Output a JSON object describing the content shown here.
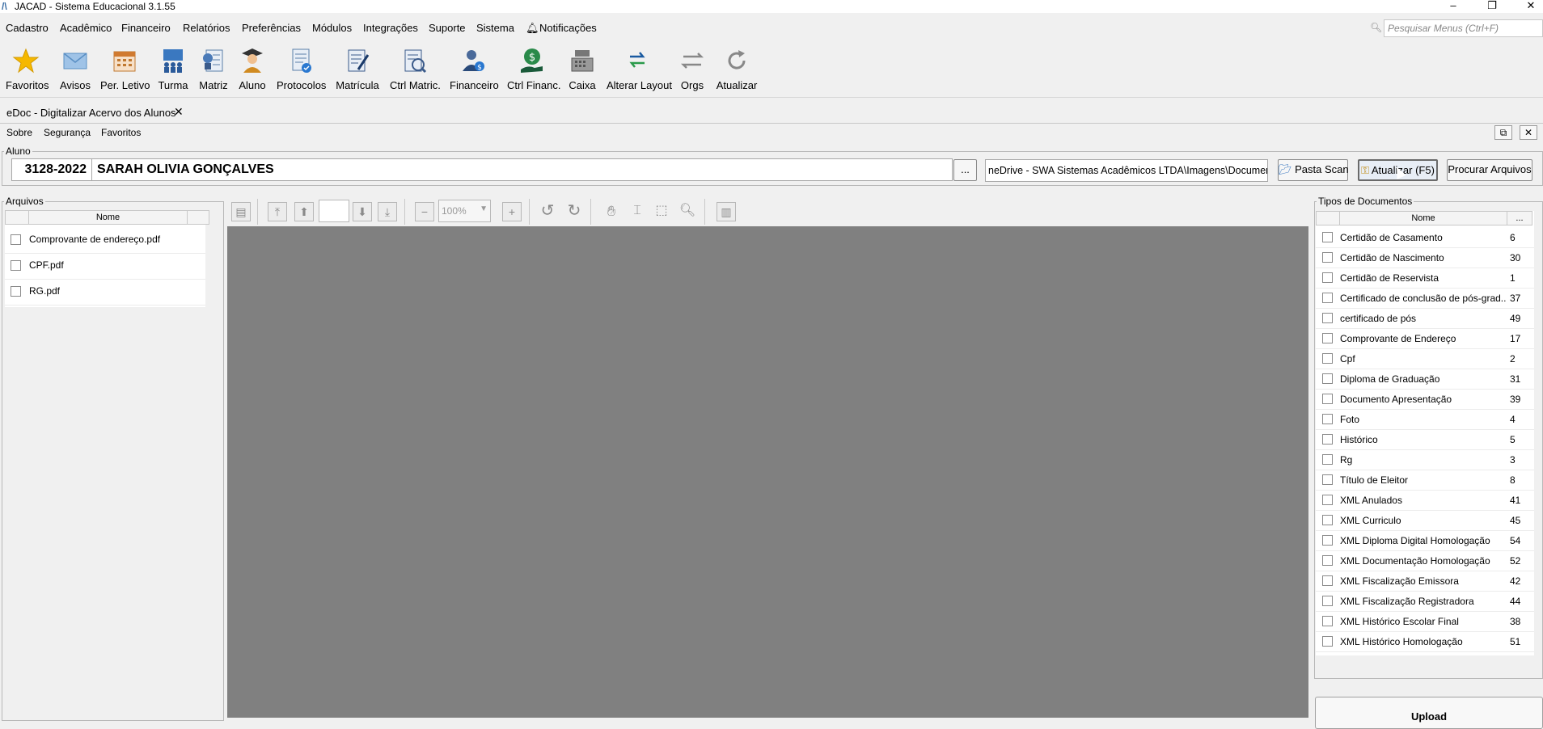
{
  "window": {
    "title": "JACAD - Sistema Educacional 3.1.55",
    "controls": [
      "minimize",
      "restore",
      "close"
    ]
  },
  "menubar": {
    "items": [
      {
        "label": "Cadastro"
      },
      {
        "label": "Acadêmico"
      },
      {
        "label": "Financeiro"
      },
      {
        "label": "Relatórios"
      },
      {
        "label": "Preferências"
      },
      {
        "label": "Módulos"
      },
      {
        "label": "Integrações"
      },
      {
        "label": "Suporte"
      },
      {
        "label": "Sistema"
      },
      {
        "label": "Notificações"
      }
    ],
    "search_placeholder": "Pesquisar Menus (Ctrl+F)"
  },
  "toolbar": {
    "items": [
      {
        "label": "Favoritos",
        "icon": "star-icon"
      },
      {
        "label": "Avisos",
        "icon": "envelope-icon"
      },
      {
        "label": "Per. Letivo",
        "icon": "calendar-icon"
      },
      {
        "label": "Turma",
        "icon": "class-group-icon"
      },
      {
        "label": "Matriz",
        "icon": "matrix-icon"
      },
      {
        "label": "Aluno",
        "icon": "student-icon"
      },
      {
        "label": "Protocolos",
        "icon": "protocol-icon"
      },
      {
        "label": "Matrícula",
        "icon": "enrollment-icon"
      },
      {
        "label": "Ctrl Matric.",
        "icon": "enrollment-control-icon"
      },
      {
        "label": "Financeiro",
        "icon": "finance-person-icon"
      },
      {
        "label": "Ctrl Financ.",
        "icon": "finance-control-icon"
      },
      {
        "label": "Caixa",
        "icon": "cash-register-icon"
      },
      {
        "label": "Alterar Layout",
        "icon": "layout-swap-icon"
      },
      {
        "label": "Orgs",
        "icon": "orgs-arrows-icon"
      },
      {
        "label": "Atualizar",
        "icon": "refresh-icon"
      }
    ]
  },
  "tab": {
    "title": "eDoc - Digitalizar Acervo dos Alunos",
    "close": "✕"
  },
  "submenu": {
    "items": [
      "Sobre",
      "Segurança",
      "Favoritos"
    ]
  },
  "aluno": {
    "legend": "Aluno",
    "code": "3128-2022",
    "name": "SARAH OLIVIA GONÇALVES",
    "ellipsis": "...",
    "path": "neDrive - SWA Sistemas Acadêmicos LTDA\\Imagens\\Documentos",
    "btn_pasta_scan": "Pasta Scan",
    "btn_atualizar": "Atualizar (F5)",
    "btn_procurar": "Procurar Arquivos"
  },
  "arquivos": {
    "legend": "Arquivos",
    "column": "Nome",
    "files": [
      "Comprovante de endereço.pdf",
      "CPF.pdf",
      "RG.pdf"
    ]
  },
  "viewer": {
    "zoom": "100%"
  },
  "tipos": {
    "legend": "Tipos de Documentos",
    "col_name": "Nome",
    "col_extra": "...",
    "items": [
      {
        "name": "Certidão de Casamento",
        "id": "6"
      },
      {
        "name": "Certidão de Nascimento",
        "id": "30"
      },
      {
        "name": "Certidão de Reservista",
        "id": "1"
      },
      {
        "name": "Certificado de conclusão de pós-grad...",
        "id": "37"
      },
      {
        "name": "certificado de pós",
        "id": "49"
      },
      {
        "name": "Comprovante de Endereço",
        "id": "17"
      },
      {
        "name": "Cpf",
        "id": "2"
      },
      {
        "name": "Diploma de Graduação",
        "id": "31"
      },
      {
        "name": "Documento Apresentação",
        "id": "39"
      },
      {
        "name": "Foto",
        "id": "4"
      },
      {
        "name": "Histórico",
        "id": "5"
      },
      {
        "name": "Rg",
        "id": "3"
      },
      {
        "name": "Título de Eleitor",
        "id": "8"
      },
      {
        "name": "XML Anulados",
        "id": "41"
      },
      {
        "name": "XML Curriculo",
        "id": "45"
      },
      {
        "name": "XML Diploma Digital Homologação",
        "id": "54"
      },
      {
        "name": "XML Documentação Homologação",
        "id": "52"
      },
      {
        "name": "XML Fiscalização Emissora",
        "id": "42"
      },
      {
        "name": "XML Fiscalização Registradora",
        "id": "44"
      },
      {
        "name": "XML Histórico Escolar Final",
        "id": "38"
      },
      {
        "name": "XML Histórico Homologação",
        "id": "51"
      }
    ],
    "upload_label": "Upload"
  }
}
